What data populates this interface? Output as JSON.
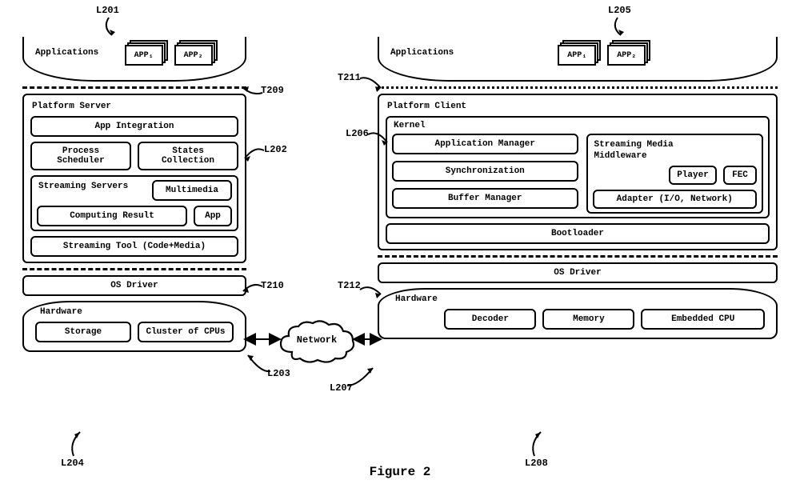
{
  "figure_title": "Figure 2",
  "labels": {
    "L201": "L201",
    "L202": "L202",
    "L203": "L203",
    "L204": "L204",
    "L205": "L205",
    "L206": "L206",
    "L207": "L207",
    "L208": "L208",
    "T209": "T209",
    "T210": "T210",
    "T211": "T211",
    "T212": "T212"
  },
  "left": {
    "apps_label": "Applications",
    "app1": "APP₁",
    "app2": "APP₂",
    "platform_server": "Platform Server",
    "app_integration": "App Integration",
    "process_scheduler": "Process Scheduler",
    "states_collection": "States Collection",
    "streaming_servers": "Streaming Servers",
    "multimedia": "Multimedia",
    "computing_result": "Computing Result",
    "app": "App",
    "streaming_tool": "Streaming Tool (Code+Media)",
    "os_driver": "OS Driver",
    "hardware": "Hardware",
    "storage": "Storage",
    "cluster_of_cpus": "Cluster of CPUs"
  },
  "right": {
    "apps_label": "Applications",
    "app1": "APP₁",
    "app2": "APP₂",
    "platform_client": "Platform Client",
    "kernel": "Kernel",
    "application_manager": "Application Manager",
    "synchronization": "Synchronization",
    "buffer_manager": "Buffer Manager",
    "streaming_media_middleware_l1": "Streaming Media",
    "streaming_media_middleware_l2": "Middleware",
    "player": "Player",
    "fec": "FEC",
    "adapter": "Adapter (I/O, Network)",
    "bootloader": "Bootloader",
    "os_driver": "OS Driver",
    "hardware": "Hardware",
    "decoder": "Decoder",
    "memory": "Memory",
    "embedded_cpu": "Embedded CPU"
  },
  "network": "Network"
}
